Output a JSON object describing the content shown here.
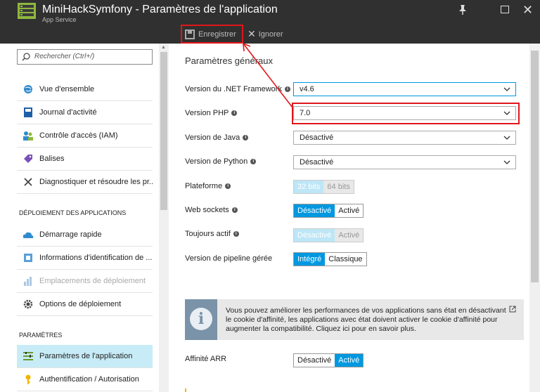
{
  "window": {
    "title": "MiniHackSymfony - Paramètres de l'application",
    "subtitle": "App Service"
  },
  "toolbar": {
    "save_label": "Enregistrer",
    "ignore_label": "Ignorer"
  },
  "sidebar": {
    "search_placeholder": "Rechercher (Ctrl+/)",
    "items": [
      {
        "label": "Vue d'ensemble",
        "icon": "globe-icon"
      },
      {
        "label": "Journal d'activité",
        "icon": "log-icon"
      },
      {
        "label": "Contrôle d'accès (IAM)",
        "icon": "users-icon"
      },
      {
        "label": "Balises",
        "icon": "tag-icon"
      },
      {
        "label": "Diagnostiquer et résoudre les pr...",
        "icon": "wrench-icon"
      }
    ],
    "deploy_header": "DÉPLOIEMENT DES APPLICATIONS",
    "deploy_items": [
      {
        "label": "Démarrage rapide",
        "icon": "cloud-icon"
      },
      {
        "label": "Informations d'identification de ...",
        "icon": "credentials-icon"
      },
      {
        "label": "Emplacements de déploiement",
        "icon": "chart-icon",
        "disabled": true
      },
      {
        "label": "Options de déploiement",
        "icon": "gear-icon"
      }
    ],
    "settings_header": "PARAMÈTRES",
    "settings_items": [
      {
        "label": "Paramètres de l'application",
        "icon": "settings-list-icon",
        "active": true
      },
      {
        "label": "Authentification / Autorisation",
        "icon": "key-icon"
      }
    ]
  },
  "main": {
    "section_title": "Paramètres généraux",
    "net_label": "Version du .NET Framework",
    "net_value": "v4.6",
    "php_label": "Version PHP",
    "php_value": "7.0",
    "java_label": "Version de Java",
    "java_value": "Désactivé",
    "python_label": "Version de Python",
    "python_value": "Désactivé",
    "platform_label": "Plateforme",
    "platform_options": [
      "32 bits",
      "64 bits"
    ],
    "websockets_label": "Web sockets",
    "websockets_options": [
      "Désactivé",
      "Activé"
    ],
    "alwayson_label": "Toujours actif",
    "alwayson_options": [
      "Désactivé",
      "Activé"
    ],
    "pipeline_label": "Version de pipeline gérée",
    "pipeline_options": [
      "Intégré",
      "Classique"
    ],
    "info_text": "Vous pouvez améliorer les performances de vos applications sans état en désactivant le cookie d'affinité, les applications avec état doivent activer le cookie d'affinité pour augmenter la compatibilité. Cliquez ici pour en savoir plus.",
    "arr_label": "Affinité ARR",
    "arr_options": [
      "Désactivé",
      "Activé"
    ]
  },
  "colors": {
    "accent": "#0098e0",
    "annotation": "#e0161a",
    "titlebar": "#303030"
  }
}
